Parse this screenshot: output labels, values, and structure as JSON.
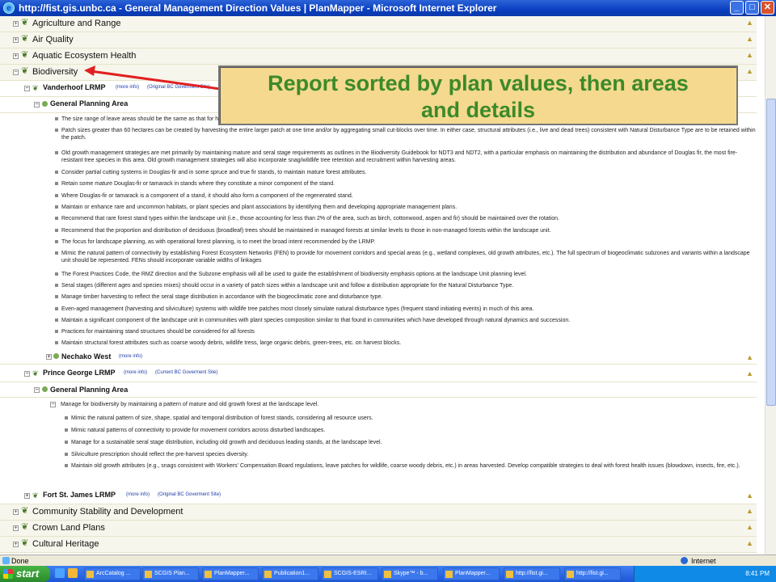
{
  "window": {
    "title": "http://fist.gis.unbc.ca - General Management Direction Values | PlanMapper - Microsoft Internet Explorer"
  },
  "categories_top": [
    "Agriculture and Range",
    "Air Quality",
    "Aquatic Ecosystem Health",
    "Biodiversity"
  ],
  "categories_bottom": [
    "Community Stability and Development",
    "Crown Land Plans",
    "Cultural Heritage"
  ],
  "callout": {
    "line1": "Report sorted by plan values, then areas",
    "line2": "and details"
  },
  "plans": {
    "vanderhoof": {
      "name": "Vanderhoof LRMP",
      "more": "(more info)",
      "site": "(Original BC Goverment Site)"
    },
    "nechako": {
      "name": "Nechako West",
      "more": "(more info)"
    },
    "princegeorge": {
      "name": "Prince George LRMP",
      "more": "(more info)",
      "site": "(Current BC Goverment Site)"
    },
    "fortstjames": {
      "name": "Fort St. James LRMP",
      "more": "(more info)",
      "site": "(Original BC Goverment Site)"
    }
  },
  "area_label": "General Planning Area",
  "vanderhoof_items": [
    "The size range of leave areas should be the same as that for harvested areas.",
    "Patch sizes greater than 60 hectares can be created by harvesting the entire larger patch at one time and/or by aggregating small cut-blocks over time. In either case, structural attributes (i.e., live and dead trees) consistent with Natural Disturbance Type are to be retained within the patch.",
    "Old growth management strategies are met primarily by maintaining mature and seral stage requirements as outlines in the Biodiversity Guidebook for NDT3 and NDT2, with a particular emphasis on maintaining the distribution and abundance of Douglas fir, the most fire-resistant tree species in this area. Old growth management strategies will also incorporate snag/wildlife tree retention and recruitment within harvesting areas.",
    "Consider partial cutting systems in Douglas-fir and in some spruce and true fir stands, to maintain mature forest attributes.",
    "Retain some mature Douglas-fir or tamarack in stands where they constitute a minor component of the stand.",
    "Where Douglas-fir or tamarack is a component of a stand, it should also form a component of the regenerated stand.",
    "Maintain or enhance rare and uncommon habitats, or plant species and plant associations by identifying them and developing appropriate management plans.",
    "Recommend that rare forest stand types within the landscape unit (i.e., those accounting for less than 2% of the area, such as birch, cottonwood, aspen and fir) should be maintained over the rotation.",
    "Recommend that the proportion and distribution of deciduous (broadleaf) trees should be maintained in managed forests at similar levels to those in non-managed forests within the landscape unit.",
    "The focus for landscape planning, as with operational forest planning, is to meet the broad intent recommended by the LRMP.",
    "Mimic the natural pattern of connectivity by establishing Forest Ecosystem Networks (FEN) to provide for movement corridors and special areas (e.g., wetland complexes, old growth attributes, etc.). The full spectrum of biogeoclimatic subzones and variants within a landscape unit should be represented. FENs should incorporate variable widths of linkages",
    "The Forest Practices Code, the RMZ direction and the Subzone emphasis will all be used to guide the establishment of biodiversity emphasis options at the landscape Unit planning level.",
    "Seral stages (different ages and species mixes) should occur in a variety of patch sizes within a landscape unit and follow a distribution appropriate for the Natural Disturbance Type.",
    "Manage timber harvesting to reflect the seral stage distribution in accordance with the biogeoclimatic zone and disturbance type.",
    "Even-aged management (harvesting and silviculture) systems with wildlife tree patches most closely simulate natural disturbance types (frequent stand initiating events) in much of this area.",
    "Maintain a significant component of the landscape unit in communities with plant species composition similar to that found in communities which have developed through natural dynamics and succession.",
    "Practices for maintaining stand structures should be considered for all forests",
    "Maintain structural forest attributes such as coarse woody debris, wildlife tress, large organic debris, green-trees, etc. on harvest blocks."
  ],
  "pg_parent": "Manage for biodiversity by maintaining a pattern of mature and old growth forest at the landscape level.",
  "pg_items": [
    "Mimic the natural pattern of size, shape, spatial and temporal distribution of forest stands, considering all resource users.",
    "Mimic natural patterns of connectivity to provide for movement corridors across disturbed landscapes.",
    "Manage for a sustainable seral stage distribution, including old growth and deciduous leading stands, at the landscape level.",
    "Silviculture prescription should reflect the pre-harvest species diversity.",
    "Maintain old growth attributes (e.g., snags consistent with Workers' Compensation Board regulations, leave patches for wildlife, coarse woody debris, etc.) in areas harvested. Develop compatible strategies to deal with forest health issues (blowdown, insects, fire, etc.)."
  ],
  "status": {
    "left": "Done",
    "zone": "Internet"
  },
  "taskbar": {
    "start": "start",
    "tasks": [
      "ArcCatalog ...",
      "SCGIS Plan...",
      "PlanMapper...",
      "Publication1...",
      "SCGIS-ESRI...",
      "Skype™ - b...",
      "PlanMapper...",
      "http://fist.gi...",
      "http://fist.gi..."
    ],
    "clock": "8:41 PM"
  },
  "colors": {
    "accent_green": "#3c8a2a",
    "callout_bg": "#f5d98f",
    "arrow": "#e02020"
  }
}
